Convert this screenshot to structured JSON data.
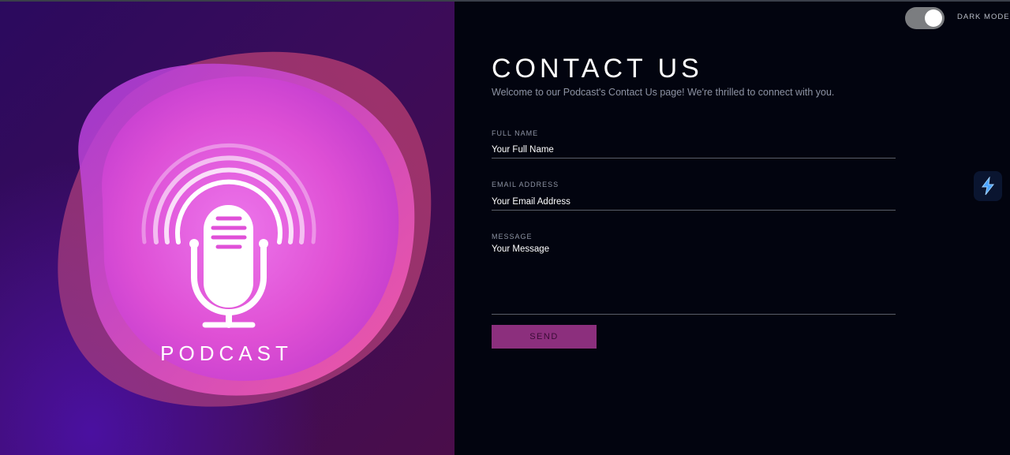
{
  "hero": {
    "logo_text": "PODCAST"
  },
  "theme_toggle": {
    "label": "DARK MODE",
    "state": "on"
  },
  "contact": {
    "title": "CONTACT US",
    "subtitle": "Welcome to our Podcast's Contact Us page! We're thrilled to connect with you.",
    "fields": [
      {
        "label": "FULL NAME",
        "placeholder": "Your Full Name"
      },
      {
        "label": "EMAIL ADDRESS",
        "placeholder": "Your Email Address"
      },
      {
        "label": "MESSAGE",
        "placeholder": "Your Message"
      }
    ],
    "send_label": "SEND"
  },
  "colors": {
    "background": "#02040f",
    "accent": "#8c2f7d",
    "hero_pink": "#e040d0",
    "hero_purple": "#3a0c5a"
  },
  "icons": {
    "hero_logo": "podcast-microphone-icon",
    "side_widget": "bolt-icon"
  }
}
